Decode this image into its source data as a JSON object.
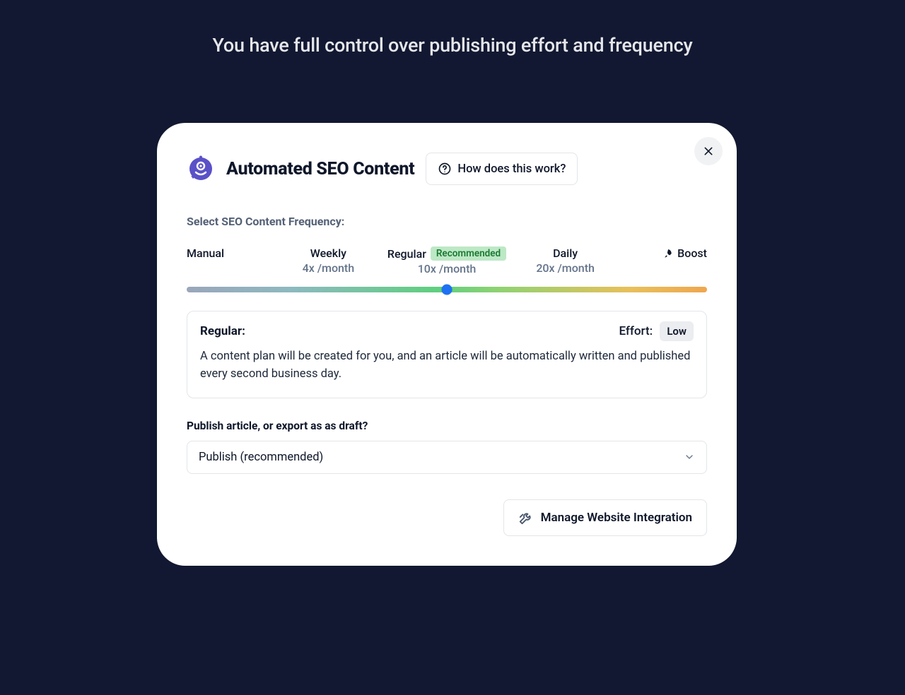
{
  "page_heading": "You have full control over publishing effort and frequency",
  "dialog": {
    "title": "Automated SEO Content",
    "help_label": "How does this work?",
    "frequency_label": "Select SEO Content Frequency:",
    "recommended_badge": "Recommended",
    "stops": [
      {
        "label": "Manual",
        "sub": ""
      },
      {
        "label": "Weekly",
        "sub": "4x /month"
      },
      {
        "label": "Regular",
        "sub": "10x /month"
      },
      {
        "label": "Daily",
        "sub": "20x /month"
      },
      {
        "label": "Boost",
        "sub": ""
      }
    ],
    "selected": {
      "name": "Regular:",
      "effort_label": "Effort:",
      "effort_value": "Low",
      "description": "A content plan will be created for you, and an article will be automatically written and published every second business day."
    },
    "publish_question": "Publish article, or export as as draft?",
    "publish_selected": "Publish (recommended)",
    "manage_label": "Manage Website Integration"
  }
}
